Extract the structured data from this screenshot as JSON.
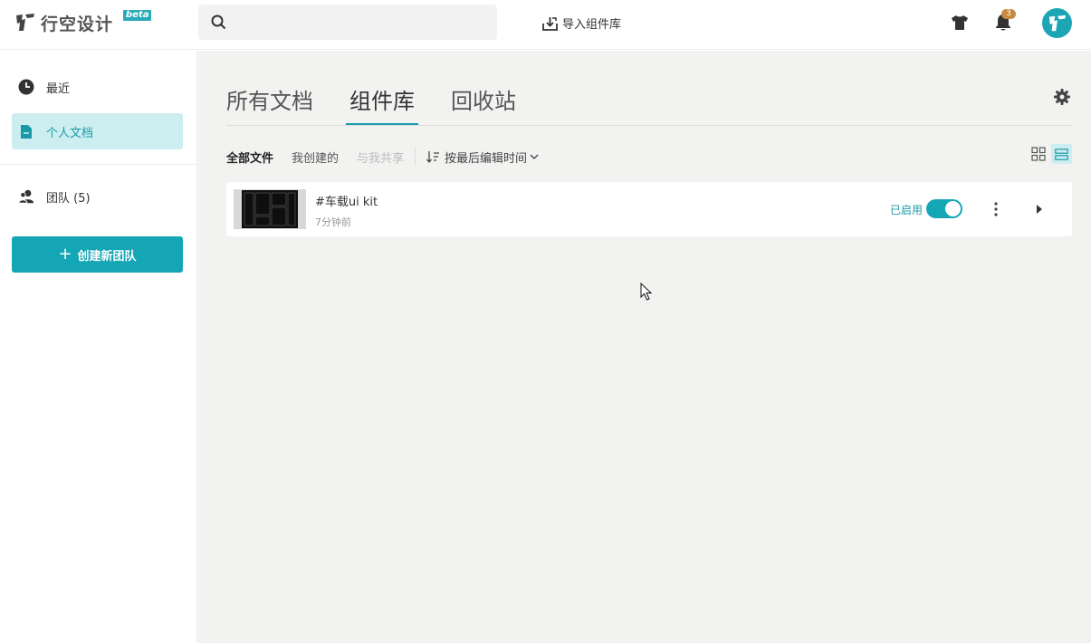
{
  "app": {
    "name": "行空设计",
    "beta_label": "beta",
    "colors": {
      "accent": "#15a6b6",
      "accent_light": "#cdeef0",
      "badge": "#c98a3f"
    }
  },
  "header": {
    "search_placeholder": "",
    "import_label": "导入组件库",
    "notification_count": "3",
    "icons": [
      "search-icon",
      "import-icon",
      "tshirt-icon",
      "bell-icon",
      "avatar"
    ]
  },
  "sidebar": {
    "items": [
      {
        "label": "最近",
        "icon": "clock-icon"
      },
      {
        "label": "个人文档",
        "icon": "file-icon",
        "active": true
      },
      {
        "label": "团队 (5)",
        "icon": "team-icon"
      }
    ],
    "create_team_label": "创建新团队"
  },
  "main": {
    "tabs": [
      {
        "label": "所有文档"
      },
      {
        "label": "组件库",
        "active": true
      },
      {
        "label": "回收站"
      }
    ],
    "filters": [
      {
        "label": "全部文件",
        "active": true
      },
      {
        "label": "我创建的"
      },
      {
        "label": "与我共享",
        "disabled": true
      }
    ],
    "sort_label": "按最后编辑时间",
    "view_mode": "list",
    "files": [
      {
        "name": "#车载ui kit",
        "time": "7分钟前",
        "status_label": "已启用",
        "enabled": true
      }
    ]
  }
}
